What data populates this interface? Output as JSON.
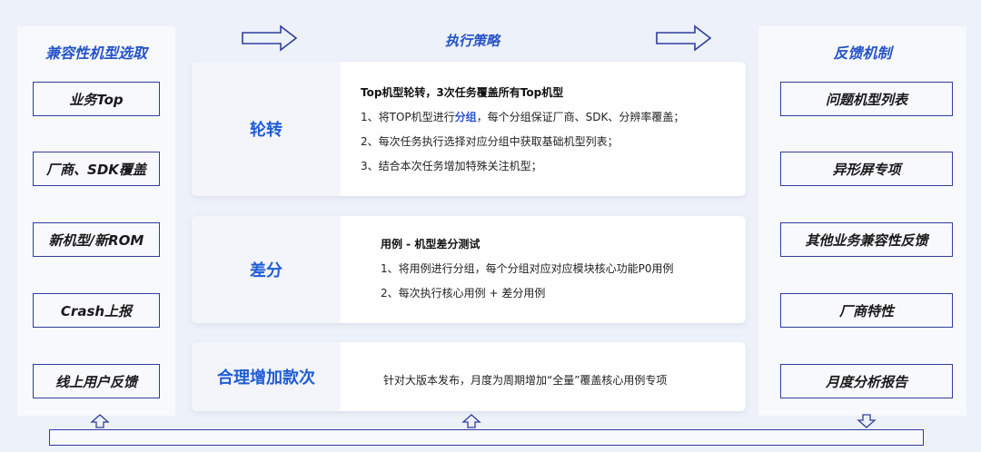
{
  "left_panel": {
    "title": "兼容性机型选取",
    "items": [
      "业务Top",
      "厂商、SDK覆盖",
      "新机型/新ROM",
      "Crash上报",
      "线上用户反馈"
    ]
  },
  "center": {
    "title": "执行策略",
    "cards": [
      {
        "label": "轮转",
        "heading": "Top机型轮转，3次任务覆盖所有Top机型",
        "line1_pre": "1、将TOP机型进行",
        "line1_hl": "分组",
        "line1_post": "，每个分组保证厂商、SDK、分辨率覆盖；",
        "line2": "2、每次任务执行选择对应分组中获取基础机型列表；",
        "line3": "3、结合本次任务增加特殊关注机型；"
      },
      {
        "label": "差分",
        "heading": "用例 - 机型差分测试",
        "line1": "1、将用例进行分组，每个分组对应对应模块核心功能P0用例",
        "line2": "2、每次执行核心用例 + 差分用例"
      },
      {
        "label": "合理增加款次",
        "line1": "针对大版本发布，月度为周期增加“全量”覆盖核心用例专项"
      }
    ]
  },
  "right_panel": {
    "title": "反馈机制",
    "items": [
      "问题机型列表",
      "异形屏专项",
      "其他业务兼容性反馈",
      "厂商特性",
      "月度分析报告"
    ]
  },
  "colors": {
    "accent": "#2454c8",
    "outline": "#2f3da0",
    "background": "#edf1f9"
  }
}
